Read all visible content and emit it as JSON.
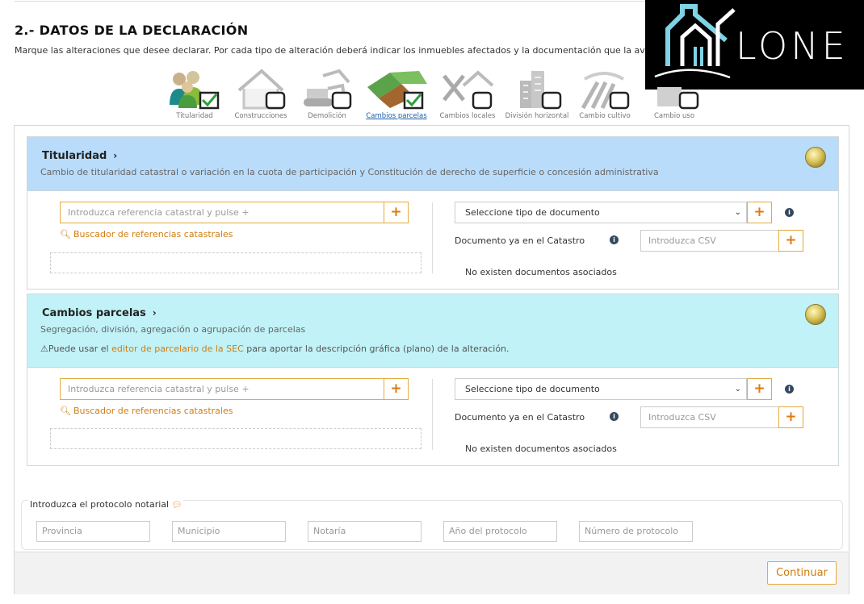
{
  "section": {
    "title": "2.- DATOS DE LA DECLARACIÓN",
    "description": "Marque las alteraciones que desee declarar. Por cada tipo de alteración deberá indicar los inmuebles afectados y la documentación que la avala"
  },
  "logo": {
    "text": "LONE"
  },
  "alterations": [
    {
      "label": "Titularidad",
      "icon": "people-icon",
      "checked": true
    },
    {
      "label": "Construcciones",
      "icon": "house-icon",
      "checked": false
    },
    {
      "label": "Demolición",
      "icon": "bulldozer-icon",
      "checked": false
    },
    {
      "label": "Cambios parcelas",
      "icon": "parcels-icon",
      "checked": true,
      "active": true
    },
    {
      "label": "Cambios locales",
      "icon": "tools-house-icon",
      "checked": false
    },
    {
      "label": "División horizontal",
      "icon": "buildings-icon",
      "checked": false
    },
    {
      "label": "Cambio cultivo",
      "icon": "field-icon",
      "checked": false
    },
    {
      "label": "Cambio uso",
      "icon": "change-use-icon",
      "checked": false
    }
  ],
  "panels": [
    {
      "title": "Titularidad",
      "subtitle": "Cambio de titularidad catastral o variación en la cuota de participación y Constitución de derecho de superficie o concesión administrativa",
      "header_color": "#b9dcfb",
      "ref_placeholder": "Introduzca referencia catastral y pulse +",
      "search_link": "Buscador de referencias catastrales",
      "doc_select": "Seleccione tipo de documento",
      "doc_in_catastro": "Documento ya en el Catastro",
      "csv_placeholder": "Introduzca CSV",
      "no_docs": "No existen documentos asociados"
    },
    {
      "title": "Cambios parcelas",
      "subtitle": "Segregación, división, agregación o agrupación de parcelas",
      "warning_pre": "Puede usar el ",
      "warning_link": "editor de parcelario de la SEC",
      "warning_post": " para aportar la descripción gráfica (plano) de la alteración.",
      "header_color": "#c0f2f7",
      "ref_placeholder": "Introduzca referencia catastral y pulse +",
      "search_link": "Buscador de referencias catastrales",
      "doc_select": "Seleccione tipo de documento",
      "doc_in_catastro": "Documento ya en el Catastro",
      "csv_placeholder": "Introduzca CSV",
      "no_docs": "No existen documentos asociados"
    }
  ],
  "notary": {
    "label": "Introduzca el protocolo notarial",
    "fields": [
      "Provincia",
      "Municipio",
      "Notaría",
      "Año del protocolo",
      "Número de protocolo"
    ]
  },
  "footer": {
    "continue_label": "Continuar"
  },
  "colors": {
    "accent": "#e07a10",
    "link_blue": "#1a5fa8"
  }
}
